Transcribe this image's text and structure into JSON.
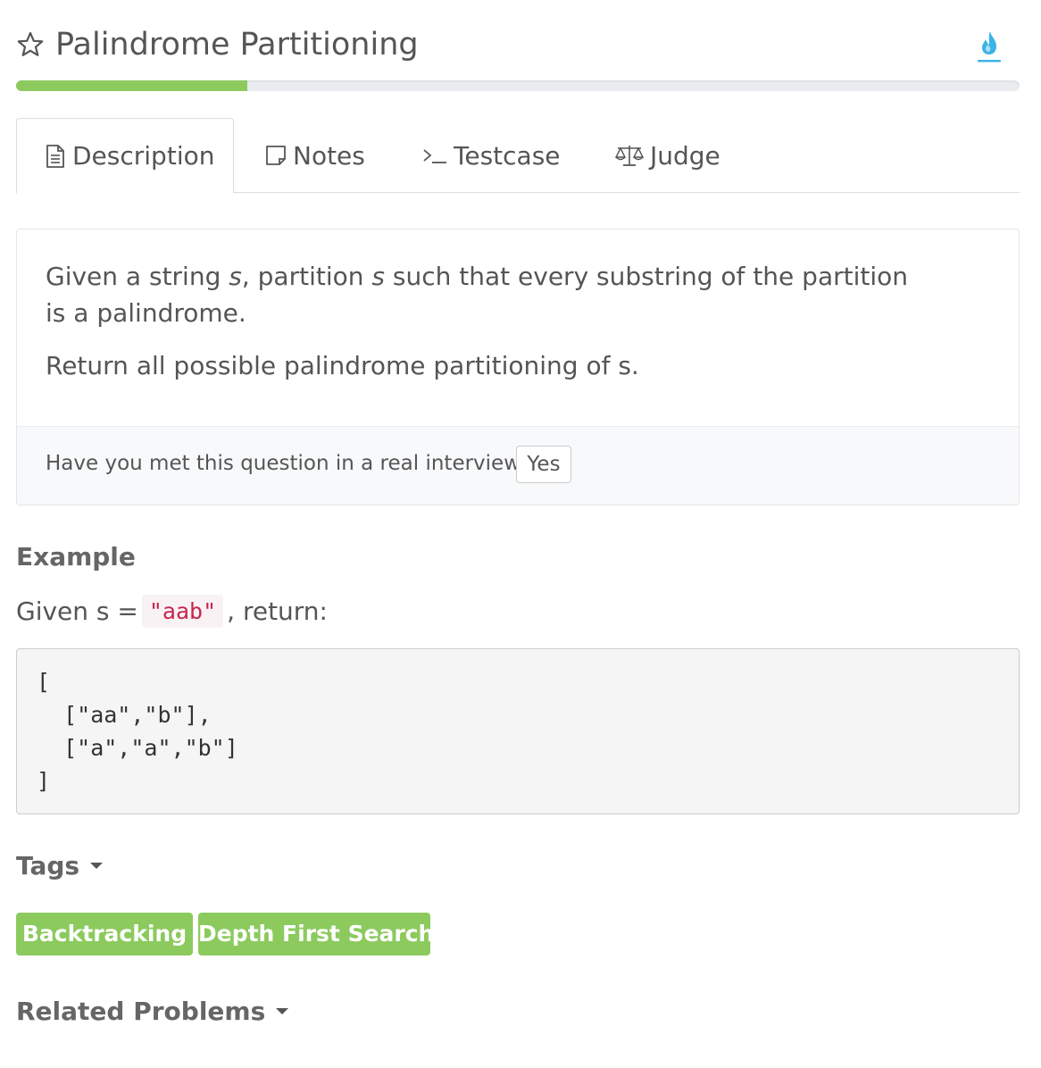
{
  "header": {
    "title": "Palindrome Partitioning",
    "progress_fraction": 0.23
  },
  "tabs": [
    {
      "label": "Description",
      "icon": "document-icon",
      "active": true
    },
    {
      "label": "Notes",
      "icon": "note-icon",
      "active": false
    },
    {
      "label": "Testcase",
      "icon": "terminal-icon",
      "active": false
    },
    {
      "label": "Judge",
      "icon": "balance-scale-icon",
      "active": false
    }
  ],
  "description": {
    "p1_given": "Given a string ",
    "p1_s1": "s",
    "p1_mid": ", partition ",
    "p1_s2": "s",
    "p1_end": " such that every substring of the partition is a palindrome.",
    "p2": "Return all possible palindrome partitioning of s.",
    "interview_question": "Have you met this question in a real interview?",
    "yes_label": "Yes"
  },
  "example": {
    "heading": "Example",
    "given_prefix": "Given s = ",
    "given_code": "\"aab\"",
    "given_suffix": ", return:",
    "code_lines": [
      "[",
      "  [\"aa\",\"b\"],",
      "  [\"a\",\"a\",\"b\"]",
      "]"
    ]
  },
  "tags": {
    "heading": "Tags",
    "items": [
      "Backtracking",
      "Depth First Search"
    ]
  },
  "related": {
    "heading": "Related Problems"
  },
  "colors": {
    "accent_green": "#8cca5e",
    "fire_blue": "#3bb4e7",
    "code_red": "#c7254e"
  }
}
